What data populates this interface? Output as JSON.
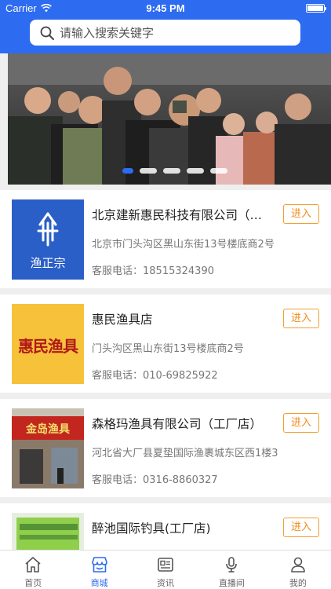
{
  "status_bar": {
    "carrier": "Carrier",
    "time": "9:45 PM"
  },
  "search": {
    "placeholder": "请输入搜索关键字"
  },
  "banner": {
    "slide_count": 5,
    "active_index": 0
  },
  "stores": [
    {
      "name": "北京建新惠民科技有限公司（北京...",
      "address": "北京市门头沟区黑山东街13号楼底商2号",
      "phone": "客服电话：18515324390",
      "enter_label": "进入",
      "logo_text": "渔正宗"
    },
    {
      "name": "惠民渔具店",
      "address": "门头沟区黑山东街13号楼底商2号",
      "phone": "客服电话：010-69825922",
      "enter_label": "进入",
      "logo_text": "惠民渔具"
    },
    {
      "name": "森格玛渔具有限公司（工厂店）",
      "address": "河北省大厂县夏垫国际渔裹城东区西1楼3",
      "phone": "客服电话：0316-8860327",
      "enter_label": "进入",
      "logo_text": "金岛渔具"
    },
    {
      "name": "醉池国际钓具(工厂店)",
      "address": "",
      "phone": "",
      "enter_label": "进入",
      "logo_text": ""
    }
  ],
  "tabs": [
    {
      "label": "首页",
      "icon": "home-icon",
      "active": false
    },
    {
      "label": "商城",
      "icon": "shop-icon",
      "active": true
    },
    {
      "label": "资讯",
      "icon": "news-icon",
      "active": false
    },
    {
      "label": "直播间",
      "icon": "microphone-icon",
      "active": false
    },
    {
      "label": "我的",
      "icon": "user-icon",
      "active": false
    }
  ],
  "colors": {
    "primary": "#2d6bf0",
    "accent": "#f08c1a",
    "background": "#efefef"
  }
}
